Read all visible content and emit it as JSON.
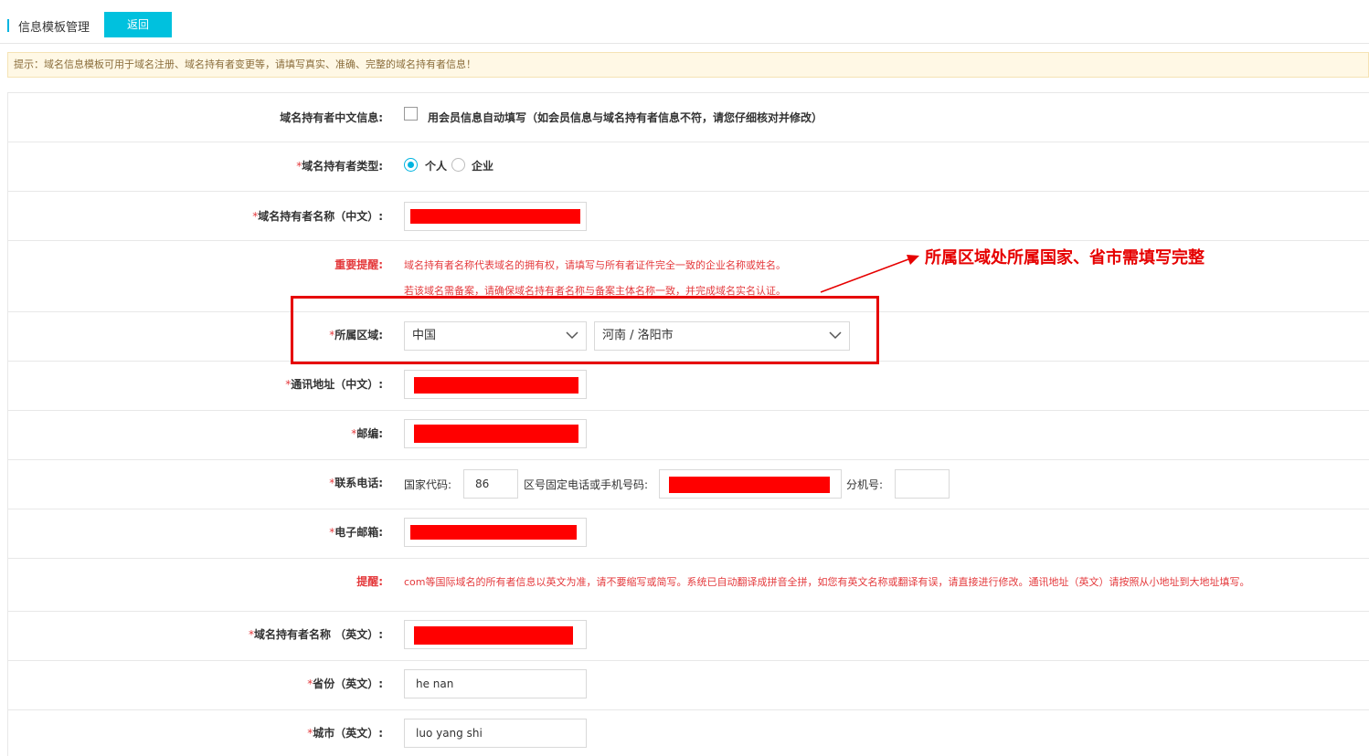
{
  "header": {
    "title": "信息模板管理",
    "back_label": "返回"
  },
  "tip": "提示：域名信息模板可用于域名注册、域名持有者变更等，请填写真实、准确、完整的域名持有者信息！",
  "form": {
    "cn_info": {
      "label": "域名持有者中文信息:",
      "checkbox_label": "用会员信息自动填写（如会员信息与域名持有者信息不符，请您仔细核对并修改）",
      "checked": false
    },
    "holder_type": {
      "label": "域名持有者类型:",
      "options": [
        "个人",
        "企业"
      ],
      "selected": "个人"
    },
    "holder_name_cn": {
      "label": "域名持有者名称（中文）:",
      "value": ""
    },
    "important": {
      "label": "重要提醒:",
      "line1": "域名持有者名称代表域名的拥有权，请填写与所有者证件完全一致的企业名称或姓名。",
      "line2": "若该域名需备案，请确保域名持有者名称与备案主体名称一致，并完成域名实名认证。"
    },
    "region": {
      "label": "所属区域:",
      "country": "中国",
      "province_city": "河南 / 洛阳市"
    },
    "address_cn": {
      "label": "通讯地址（中文）:",
      "value": ""
    },
    "postcode": {
      "label": "邮编:",
      "value": ""
    },
    "phone": {
      "label": "联系电话:",
      "country_code_label": "国家代码:",
      "country_code": "86",
      "number_label": "区号固定电话或手机号码:",
      "number": "",
      "ext_label": "分机号:",
      "ext": ""
    },
    "email": {
      "label": "电子邮箱:",
      "value": ""
    },
    "notice": {
      "label": "提醒:",
      "text": "com等国际域名的所有者信息以英文为准，请不要缩写或简写。系统已自动翻译成拼音全拼，如您有英文名称或翻译有误，请直接进行修改。通讯地址（英文）请按照从小地址到大地址填写。"
    },
    "holder_name_en": {
      "label": "域名持有者名称 （英文）:",
      "value": ""
    },
    "province_en": {
      "label": "省份（英文）:",
      "value": "he nan"
    },
    "city_en": {
      "label": "城市（英文）:",
      "value": "luo yang shi"
    }
  },
  "annotation": {
    "text": "所属区域处所属国家、省市需填写完整",
    "color": "#e60000"
  },
  "colors": {
    "accent": "#00c1de",
    "required": "#e4393c",
    "redaction": "#ff0000"
  }
}
